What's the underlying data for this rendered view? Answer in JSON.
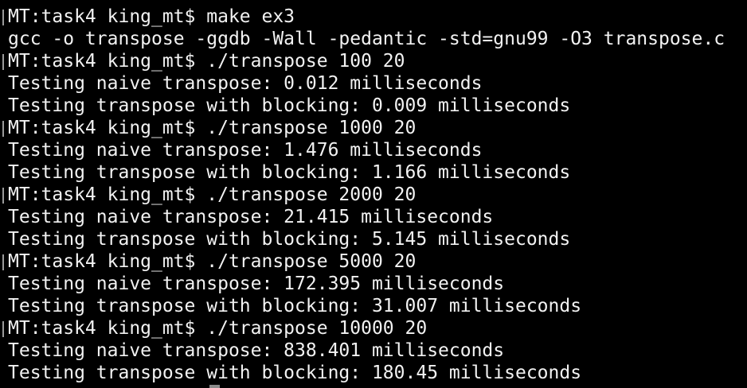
{
  "terminal": {
    "background": "#000000",
    "foreground": "#f2f2f2",
    "lines": [
      {
        "text": "MT:task4 king_mt$ make ex3",
        "is_prompt": true
      },
      {
        "text": "gcc -o transpose -ggdb -Wall -pedantic -std=gnu99 -O3 transpose.c",
        "is_prompt": false
      },
      {
        "text": "MT:task4 king_mt$ ./transpose 100 20",
        "is_prompt": true
      },
      {
        "text": "Testing naive transpose: 0.012 milliseconds",
        "is_prompt": false
      },
      {
        "text": "Testing transpose with blocking: 0.009 milliseconds",
        "is_prompt": false
      },
      {
        "text": "MT:task4 king_mt$ ./transpose 1000 20",
        "is_prompt": true
      },
      {
        "text": "Testing naive transpose: 1.476 milliseconds",
        "is_prompt": false
      },
      {
        "text": "Testing transpose with blocking: 1.166 milliseconds",
        "is_prompt": false
      },
      {
        "text": "MT:task4 king_mt$ ./transpose 2000 20",
        "is_prompt": true
      },
      {
        "text": "Testing naive transpose: 21.415 milliseconds",
        "is_prompt": false
      },
      {
        "text": "Testing transpose with blocking: 5.145 milliseconds",
        "is_prompt": false
      },
      {
        "text": "MT:task4 king_mt$ ./transpose 5000 20",
        "is_prompt": true
      },
      {
        "text": "Testing naive transpose: 172.395 milliseconds",
        "is_prompt": false
      },
      {
        "text": "Testing transpose with blocking: 31.007 milliseconds",
        "is_prompt": false
      },
      {
        "text": "MT:task4 king_mt$ ./transpose 10000 20",
        "is_prompt": true
      },
      {
        "text": "Testing naive transpose: 838.401 milliseconds",
        "is_prompt": false
      },
      {
        "text": "Testing transpose with blocking: 180.45 milliseconds",
        "is_prompt": false
      }
    ]
  }
}
